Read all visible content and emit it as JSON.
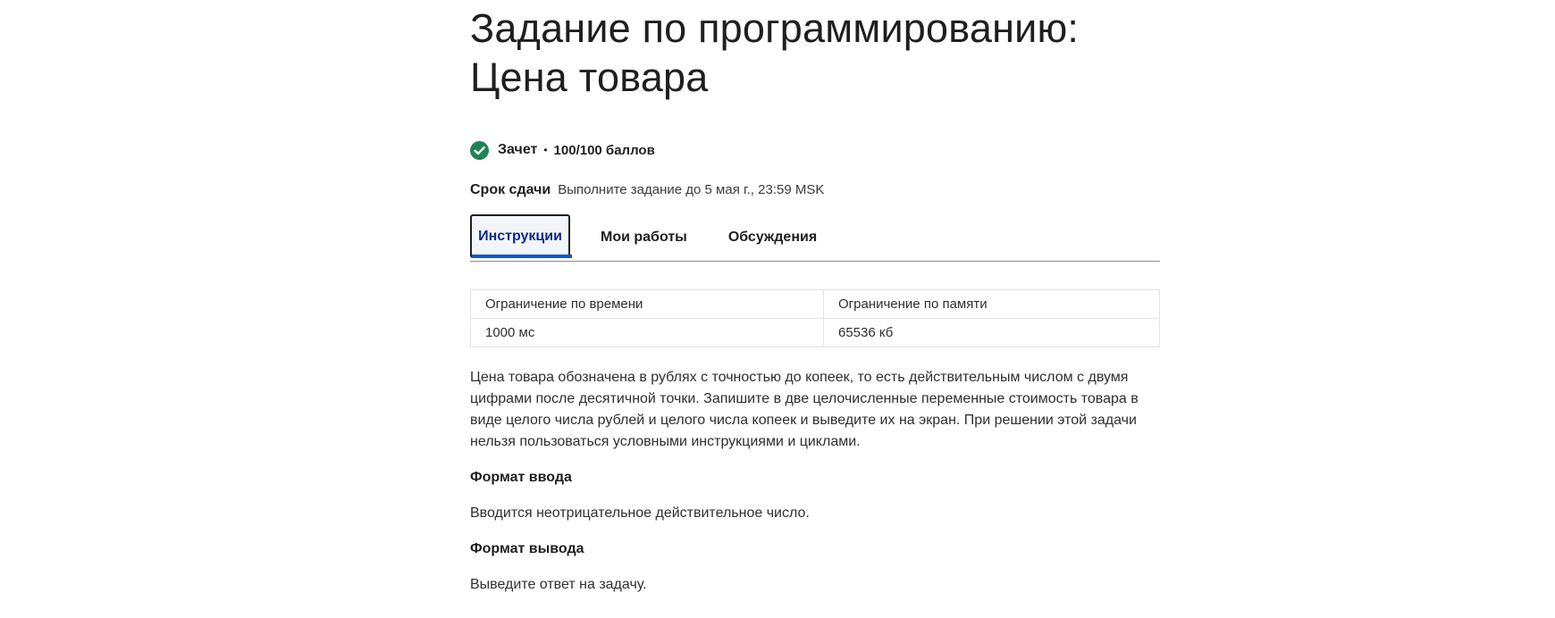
{
  "assignment": {
    "title": "Задание по программированию: Цена товара",
    "status": "Зачет",
    "status_color": "#1f8354",
    "score": "100/100 баллов",
    "deadline_label": "Срок сдачи",
    "deadline_value": "Выполните задание до 5 мая г., 23:59 MSK"
  },
  "tabs": [
    {
      "label": "Инструкции",
      "active": true
    },
    {
      "label": "Мои работы",
      "active": false
    },
    {
      "label": "Обсуждения",
      "active": false
    }
  ],
  "limits_table": {
    "headers": [
      "Ограничение по времени",
      "Ограничение по памяти"
    ],
    "values": [
      "1000 мс",
      "65536 кб"
    ]
  },
  "instructions": {
    "description": "Цена товара обозначена в рублях с точностью до копеек, то есть действительным числом с двумя цифрами после десятичной точки. Запишите в две целочисленные переменные стоимость товара в виде целого числа рублей и целого числа копеек и выведите их на экран. При решении этой задачи нельзя пользоваться условными инструкциями и циклами.",
    "input_heading": "Формат ввода",
    "input_text": "Вводится неотрицательное действительное число.",
    "output_heading": "Формат вывода",
    "output_text": "Выведите ответ на задачу."
  },
  "colors": {
    "accent": "#0b57d0",
    "active_tab_text": "#0b2a8a"
  },
  "icons": {
    "status": "check-circle-icon"
  }
}
